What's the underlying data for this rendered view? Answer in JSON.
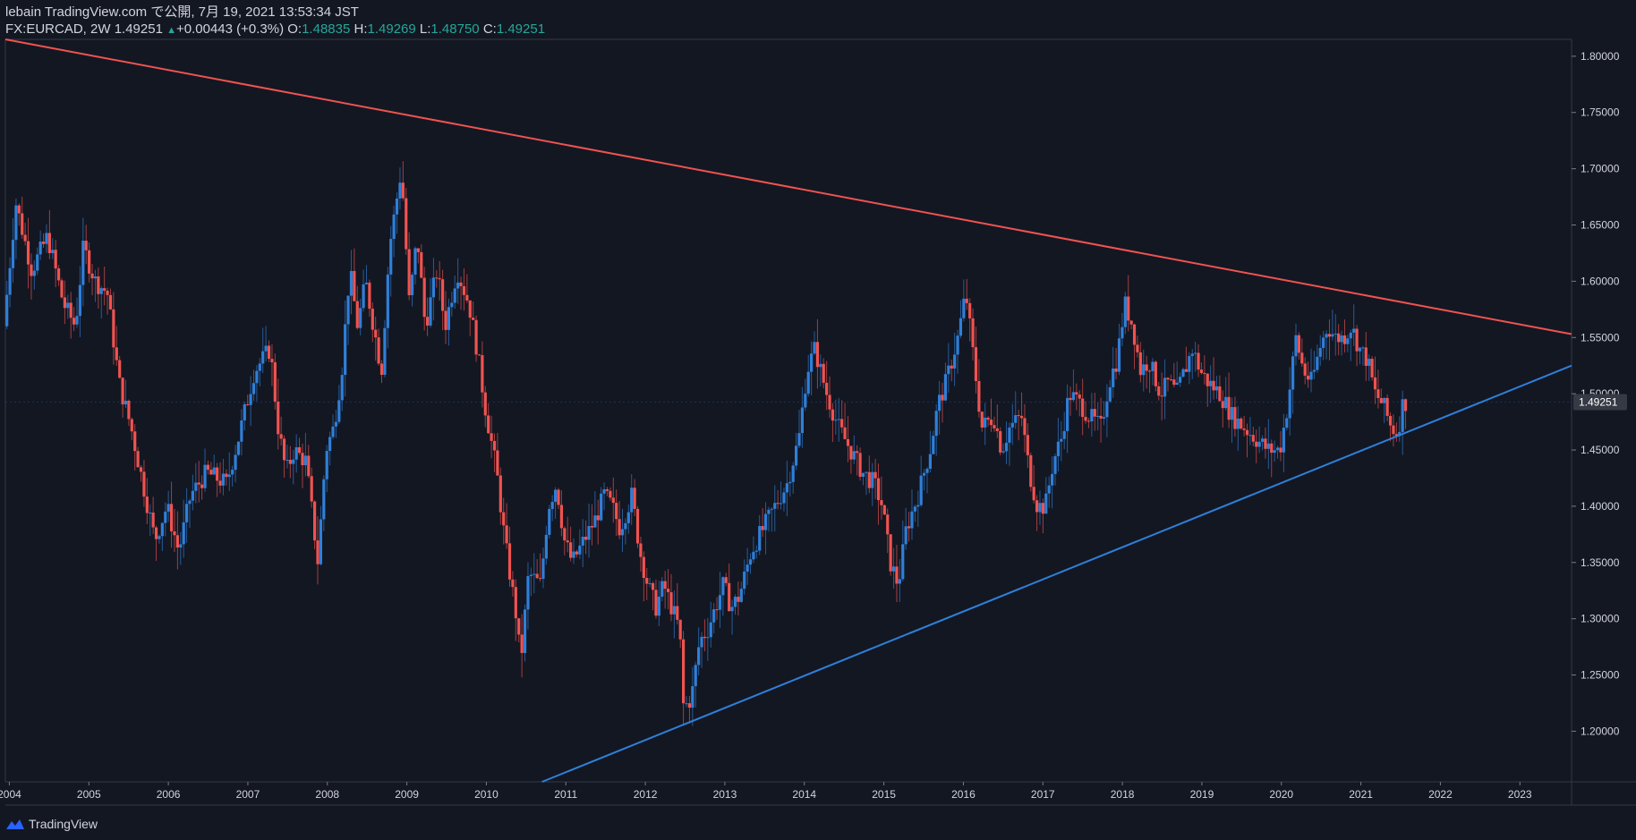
{
  "header": {
    "publisher_line": "lebain TradingView.com で公開, 7月 19, 2021 13:53:34 JST",
    "symbol": "FX:EURCAD, 2W",
    "last": "1.49251",
    "change": "+0.00443 (+0.3%)",
    "o_label": "O:",
    "o_value": "1.48835",
    "h_label": "H:",
    "h_value": "1.49269",
    "l_label": "L:",
    "l_value": "1.48750",
    "c_label": "C:",
    "c_value": "1.49251"
  },
  "footer": {
    "brand": "TradingView",
    "logo_icon": "tradingview-logo-icon"
  },
  "colors": {
    "background": "#131722",
    "up": "#2f7fd8",
    "down": "#ef5350",
    "resistance": "#ef5350",
    "support": "#2f7fd8",
    "axis_text": "#d1d4dc",
    "frame": "#363a45"
  },
  "chart_data": {
    "type": "candlestick",
    "title": "",
    "symbol": "FX:EURCAD",
    "interval": "2W",
    "x_range": [
      2003.95,
      2023.65
    ],
    "y_range": [
      1.155,
      1.815
    ],
    "x_ticks": [
      "2004",
      "2005",
      "2006",
      "2007",
      "2008",
      "2009",
      "2010",
      "2011",
      "2012",
      "2013",
      "2014",
      "2015",
      "2016",
      "2017",
      "2018",
      "2019",
      "2020",
      "2021",
      "2022",
      "2023"
    ],
    "y_ticks": [
      "1.20000",
      "1.25000",
      "1.30000",
      "1.35000",
      "1.40000",
      "1.45000",
      "1.50000",
      "1.55000",
      "1.60000",
      "1.65000",
      "1.70000",
      "1.75000",
      "1.80000"
    ],
    "last_price": 1.49251,
    "last_price_label": "1.49251",
    "grid": false,
    "trendlines": [
      {
        "name": "",
        "color": "#ef5350",
        "points": [
          [
            2003.95,
            1.815
          ],
          [
            2023.65,
            1.553
          ]
        ]
      },
      {
        "name": "",
        "color": "#2f7fd8",
        "points": [
          [
            2010.7,
            1.155
          ],
          [
            2023.65,
            1.525
          ]
        ]
      }
    ],
    "price_path": [
      [
        2003.95,
        1.56
      ],
      [
        2004.1,
        1.67
      ],
      [
        2004.3,
        1.61
      ],
      [
        2004.5,
        1.64
      ],
      [
        2004.7,
        1.58
      ],
      [
        2004.85,
        1.56
      ],
      [
        2004.95,
        1.63
      ],
      [
        2005.1,
        1.6
      ],
      [
        2005.25,
        1.59
      ],
      [
        2005.4,
        1.51
      ],
      [
        2005.55,
        1.47
      ],
      [
        2005.7,
        1.42
      ],
      [
        2005.85,
        1.37
      ],
      [
        2006.0,
        1.4
      ],
      [
        2006.15,
        1.36
      ],
      [
        2006.3,
        1.41
      ],
      [
        2006.5,
        1.43
      ],
      [
        2006.75,
        1.42
      ],
      [
        2006.9,
        1.46
      ],
      [
        2007.0,
        1.49
      ],
      [
        2007.1,
        1.52
      ],
      [
        2007.3,
        1.54
      ],
      [
        2007.4,
        1.47
      ],
      [
        2007.5,
        1.43
      ],
      [
        2007.6,
        1.45
      ],
      [
        2007.75,
        1.44
      ],
      [
        2007.85,
        1.38
      ],
      [
        2007.9,
        1.35
      ],
      [
        2008.0,
        1.45
      ],
      [
        2008.1,
        1.47
      ],
      [
        2008.2,
        1.52
      ],
      [
        2008.3,
        1.61
      ],
      [
        2008.4,
        1.56
      ],
      [
        2008.5,
        1.6
      ],
      [
        2008.6,
        1.56
      ],
      [
        2008.7,
        1.52
      ],
      [
        2008.8,
        1.63
      ],
      [
        2008.95,
        1.7
      ],
      [
        2009.05,
        1.58
      ],
      [
        2009.15,
        1.64
      ],
      [
        2009.25,
        1.56
      ],
      [
        2009.4,
        1.61
      ],
      [
        2009.5,
        1.56
      ],
      [
        2009.65,
        1.61
      ],
      [
        2009.8,
        1.58
      ],
      [
        2009.9,
        1.54
      ],
      [
        2010.0,
        1.49
      ],
      [
        2010.15,
        1.43
      ],
      [
        2010.25,
        1.37
      ],
      [
        2010.4,
        1.3
      ],
      [
        2010.45,
        1.26
      ],
      [
        2010.55,
        1.34
      ],
      [
        2010.7,
        1.33
      ],
      [
        2010.8,
        1.4
      ],
      [
        2010.9,
        1.42
      ],
      [
        2011.0,
        1.37
      ],
      [
        2011.1,
        1.35
      ],
      [
        2011.25,
        1.37
      ],
      [
        2011.4,
        1.39
      ],
      [
        2011.5,
        1.41
      ],
      [
        2011.6,
        1.4
      ],
      [
        2011.7,
        1.38
      ],
      [
        2011.85,
        1.41
      ],
      [
        2011.95,
        1.36
      ],
      [
        2012.05,
        1.33
      ],
      [
        2012.15,
        1.31
      ],
      [
        2012.25,
        1.33
      ],
      [
        2012.35,
        1.31
      ],
      [
        2012.45,
        1.29
      ],
      [
        2012.5,
        1.22
      ],
      [
        2012.6,
        1.23
      ],
      [
        2012.7,
        1.28
      ],
      [
        2012.8,
        1.29
      ],
      [
        2012.9,
        1.31
      ],
      [
        2013.0,
        1.33
      ],
      [
        2013.1,
        1.31
      ],
      [
        2013.2,
        1.32
      ],
      [
        2013.35,
        1.36
      ],
      [
        2013.5,
        1.38
      ],
      [
        2013.65,
        1.4
      ],
      [
        2013.8,
        1.42
      ],
      [
        2013.95,
        1.46
      ],
      [
        2014.05,
        1.52
      ],
      [
        2014.15,
        1.54
      ],
      [
        2014.3,
        1.5
      ],
      [
        2014.45,
        1.47
      ],
      [
        2014.6,
        1.45
      ],
      [
        2014.75,
        1.43
      ],
      [
        2014.9,
        1.42
      ],
      [
        2015.0,
        1.4
      ],
      [
        2015.1,
        1.35
      ],
      [
        2015.2,
        1.33
      ],
      [
        2015.3,
        1.38
      ],
      [
        2015.45,
        1.41
      ],
      [
        2015.6,
        1.45
      ],
      [
        2015.7,
        1.49
      ],
      [
        2015.8,
        1.51
      ],
      [
        2015.95,
        1.55
      ],
      [
        2016.05,
        1.59
      ],
      [
        2016.15,
        1.53
      ],
      [
        2016.25,
        1.47
      ],
      [
        2016.4,
        1.48
      ],
      [
        2016.5,
        1.45
      ],
      [
        2016.6,
        1.47
      ],
      [
        2016.75,
        1.48
      ],
      [
        2016.85,
        1.43
      ],
      [
        2016.95,
        1.4
      ],
      [
        2017.05,
        1.4
      ],
      [
        2017.15,
        1.44
      ],
      [
        2017.25,
        1.46
      ],
      [
        2017.35,
        1.5
      ],
      [
        2017.5,
        1.49
      ],
      [
        2017.6,
        1.48
      ],
      [
        2017.75,
        1.47
      ],
      [
        2017.85,
        1.51
      ],
      [
        2017.95,
        1.53
      ],
      [
        2018.05,
        1.58
      ],
      [
        2018.15,
        1.56
      ],
      [
        2018.25,
        1.52
      ],
      [
        2018.35,
        1.53
      ],
      [
        2018.5,
        1.5
      ],
      [
        2018.6,
        1.51
      ],
      [
        2018.7,
        1.5
      ],
      [
        2018.8,
        1.52
      ],
      [
        2018.9,
        1.54
      ],
      [
        2019.0,
        1.52
      ],
      [
        2019.1,
        1.51
      ],
      [
        2019.25,
        1.5
      ],
      [
        2019.4,
        1.48
      ],
      [
        2019.55,
        1.47
      ],
      [
        2019.7,
        1.46
      ],
      [
        2019.85,
        1.45
      ],
      [
        2020.0,
        1.45
      ],
      [
        2020.1,
        1.49
      ],
      [
        2020.2,
        1.55
      ],
      [
        2020.3,
        1.52
      ],
      [
        2020.4,
        1.51
      ],
      [
        2020.5,
        1.54
      ],
      [
        2020.6,
        1.56
      ],
      [
        2020.7,
        1.55
      ],
      [
        2020.8,
        1.55
      ],
      [
        2020.9,
        1.56
      ],
      [
        2021.0,
        1.54
      ],
      [
        2021.1,
        1.53
      ],
      [
        2021.2,
        1.5
      ],
      [
        2021.3,
        1.49
      ],
      [
        2021.4,
        1.47
      ],
      [
        2021.48,
        1.465
      ],
      [
        2021.55,
        1.49251
      ]
    ]
  }
}
